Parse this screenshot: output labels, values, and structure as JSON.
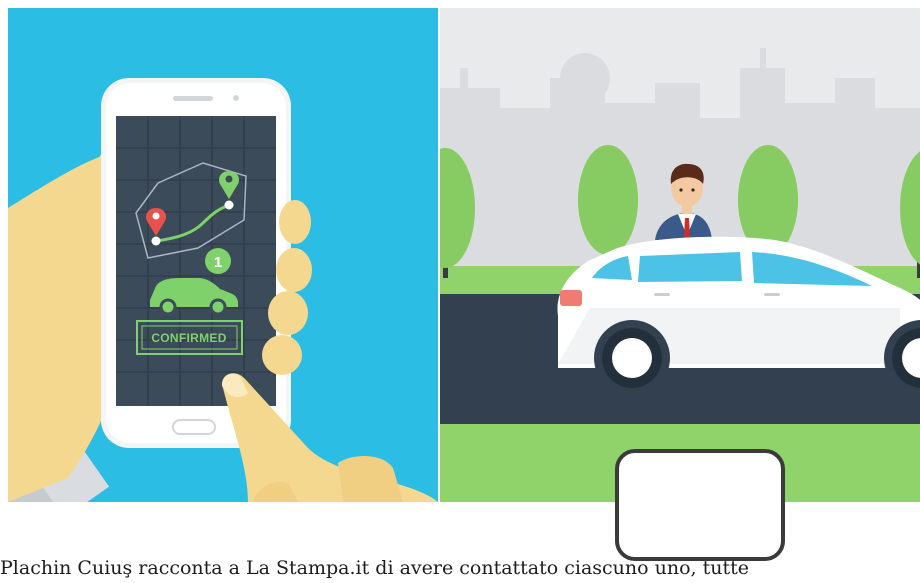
{
  "phone": {
    "status_label": "CONFIRMED",
    "badge_number": "1"
  },
  "caption": {
    "text": "Plachin Cuiuş racconta a La Stampa.it di avere contattato ciascuno uno, tutte"
  },
  "colors": {
    "sky_blue": "#2bbde3",
    "map_dark": "#3c4b59",
    "route_green": "#7fd16b",
    "pin_red": "#e9514c",
    "road": "#32404f",
    "grass": "#8fd36a",
    "car_body": "#ffffff",
    "car_window": "#4cc2e6"
  },
  "icons": [
    "map-pin-icon",
    "car-icon",
    "person-icon",
    "tree-icon"
  ]
}
